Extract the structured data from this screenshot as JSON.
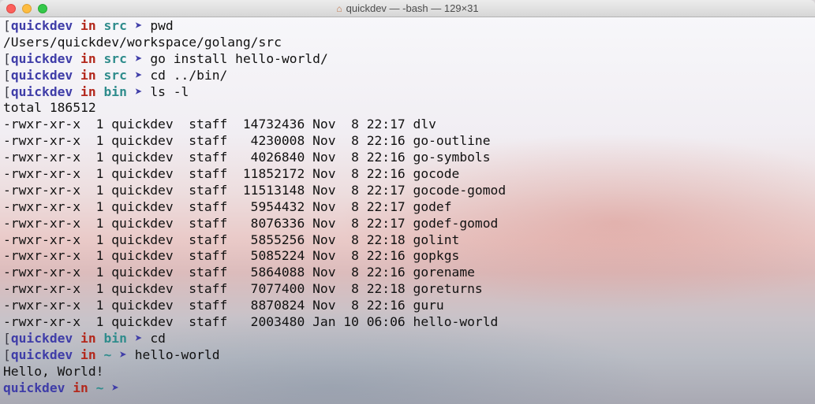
{
  "window": {
    "title": "quickdev — -bash — 129×31",
    "home_icon": "⌂"
  },
  "prompts": [
    {
      "bracket": "[",
      "user": "quickdev",
      "in": "in",
      "dir": "src",
      "arrow": "➤",
      "command": "pwd"
    },
    {
      "bracket": "[",
      "user": "quickdev",
      "in": "in",
      "dir": "src",
      "arrow": "➤",
      "command": "go install hello-world/"
    },
    {
      "bracket": "[",
      "user": "quickdev",
      "in": "in",
      "dir": "src",
      "arrow": "➤",
      "command": "cd ../bin/"
    },
    {
      "bracket": "[",
      "user": "quickdev",
      "in": "in",
      "dir": "bin",
      "arrow": "➤",
      "command": "ls -l"
    },
    {
      "bracket": "[",
      "user": "quickdev",
      "in": "in",
      "dir": "bin",
      "arrow": "➤",
      "command": "cd"
    },
    {
      "bracket": "[",
      "user": "quickdev",
      "in": "in",
      "dir": "~",
      "arrow": "➤",
      "command": "hello-world"
    },
    {
      "bracket": "",
      "user": "quickdev",
      "in": "in",
      "dir": "~",
      "arrow": "➤",
      "command": ""
    }
  ],
  "outputs": {
    "pwd": "/Users/quickdev/workspace/golang/src",
    "total": "total 186512",
    "hello": "Hello, World!"
  },
  "listing": [
    "-rwxr-xr-x  1 quickdev  staff  14732436 Nov  8 22:17 dlv",
    "-rwxr-xr-x  1 quickdev  staff   4230008 Nov  8 22:16 go-outline",
    "-rwxr-xr-x  1 quickdev  staff   4026840 Nov  8 22:16 go-symbols",
    "-rwxr-xr-x  1 quickdev  staff  11852172 Nov  8 22:16 gocode",
    "-rwxr-xr-x  1 quickdev  staff  11513148 Nov  8 22:17 gocode-gomod",
    "-rwxr-xr-x  1 quickdev  staff   5954432 Nov  8 22:17 godef",
    "-rwxr-xr-x  1 quickdev  staff   8076336 Nov  8 22:17 godef-gomod",
    "-rwxr-xr-x  1 quickdev  staff   5855256 Nov  8 22:18 golint",
    "-rwxr-xr-x  1 quickdev  staff   5085224 Nov  8 22:16 gopkgs",
    "-rwxr-xr-x  1 quickdev  staff   5864088 Nov  8 22:16 gorename",
    "-rwxr-xr-x  1 quickdev  staff   7077400 Nov  8 22:18 goreturns",
    "-rwxr-xr-x  1 quickdev  staff   8870824 Nov  8 22:16 guru",
    "-rwxr-xr-x  1 quickdev  staff   2003480 Jan 10 06:06 hello-world"
  ],
  "colors": {
    "user": "#3f3da8",
    "in": "#b3281c",
    "dir": "#2f8c8c",
    "text": "#111111"
  }
}
